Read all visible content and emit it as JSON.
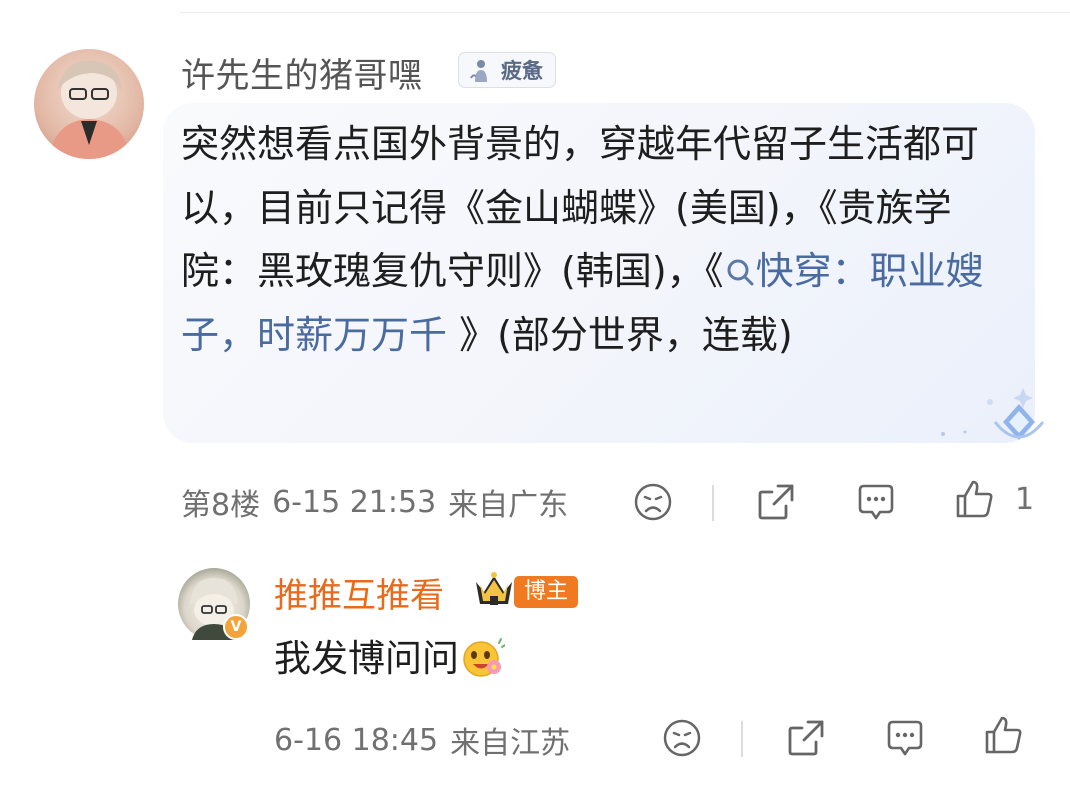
{
  "comment": {
    "username": "许先生的猪哥嘿",
    "mood_badge": "疲惫",
    "text_parts": {
      "p1": "突然想看点国外背景的，穿越年代留子生活都可以，目前只记得《金山蝴蝶》(美国)，《贵族学院：黑玫瑰复仇守则》(韩国)，《",
      "link": "快穿：职业嫂子，时薪万万千",
      "p2": " 》(部分世界，连载)"
    },
    "floor": "第8楼",
    "time": "6-15 21:53",
    "location": "来自广东",
    "like_count": "1"
  },
  "reply": {
    "username": "推推互推看",
    "tag": "博主",
    "text": "我发博问问",
    "time": "6-16 18:45",
    "location": "来自江苏"
  },
  "icons": [
    "mood-icon",
    "share-icon",
    "comment-icon",
    "like-icon",
    "search-icon",
    "crown-icon",
    "verify-icon",
    "emoji"
  ],
  "colors": {
    "link": "#4a6ba0",
    "reply_name": "#e76a1d",
    "tag": "#f07a22",
    "meta": "#707070"
  }
}
